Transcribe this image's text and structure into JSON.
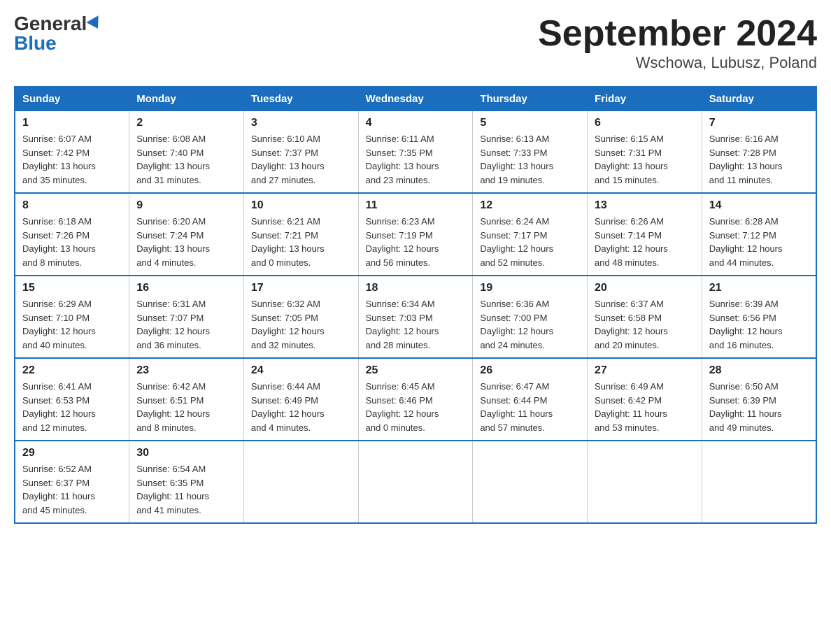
{
  "header": {
    "logo_general": "General",
    "logo_blue": "Blue",
    "month_title": "September 2024",
    "location": "Wschowa, Lubusz, Poland"
  },
  "days_of_week": [
    "Sunday",
    "Monday",
    "Tuesday",
    "Wednesday",
    "Thursday",
    "Friday",
    "Saturday"
  ],
  "weeks": [
    [
      {
        "day": "1",
        "sunrise": "6:07 AM",
        "sunset": "7:42 PM",
        "daylight": "13 hours and 35 minutes."
      },
      {
        "day": "2",
        "sunrise": "6:08 AM",
        "sunset": "7:40 PM",
        "daylight": "13 hours and 31 minutes."
      },
      {
        "day": "3",
        "sunrise": "6:10 AM",
        "sunset": "7:37 PM",
        "daylight": "13 hours and 27 minutes."
      },
      {
        "day": "4",
        "sunrise": "6:11 AM",
        "sunset": "7:35 PM",
        "daylight": "13 hours and 23 minutes."
      },
      {
        "day": "5",
        "sunrise": "6:13 AM",
        "sunset": "7:33 PM",
        "daylight": "13 hours and 19 minutes."
      },
      {
        "day": "6",
        "sunrise": "6:15 AM",
        "sunset": "7:31 PM",
        "daylight": "13 hours and 15 minutes."
      },
      {
        "day": "7",
        "sunrise": "6:16 AM",
        "sunset": "7:28 PM",
        "daylight": "13 hours and 11 minutes."
      }
    ],
    [
      {
        "day": "8",
        "sunrise": "6:18 AM",
        "sunset": "7:26 PM",
        "daylight": "13 hours and 8 minutes."
      },
      {
        "day": "9",
        "sunrise": "6:20 AM",
        "sunset": "7:24 PM",
        "daylight": "13 hours and 4 minutes."
      },
      {
        "day": "10",
        "sunrise": "6:21 AM",
        "sunset": "7:21 PM",
        "daylight": "13 hours and 0 minutes."
      },
      {
        "day": "11",
        "sunrise": "6:23 AM",
        "sunset": "7:19 PM",
        "daylight": "12 hours and 56 minutes."
      },
      {
        "day": "12",
        "sunrise": "6:24 AM",
        "sunset": "7:17 PM",
        "daylight": "12 hours and 52 minutes."
      },
      {
        "day": "13",
        "sunrise": "6:26 AM",
        "sunset": "7:14 PM",
        "daylight": "12 hours and 48 minutes."
      },
      {
        "day": "14",
        "sunrise": "6:28 AM",
        "sunset": "7:12 PM",
        "daylight": "12 hours and 44 minutes."
      }
    ],
    [
      {
        "day": "15",
        "sunrise": "6:29 AM",
        "sunset": "7:10 PM",
        "daylight": "12 hours and 40 minutes."
      },
      {
        "day": "16",
        "sunrise": "6:31 AM",
        "sunset": "7:07 PM",
        "daylight": "12 hours and 36 minutes."
      },
      {
        "day": "17",
        "sunrise": "6:32 AM",
        "sunset": "7:05 PM",
        "daylight": "12 hours and 32 minutes."
      },
      {
        "day": "18",
        "sunrise": "6:34 AM",
        "sunset": "7:03 PM",
        "daylight": "12 hours and 28 minutes."
      },
      {
        "day": "19",
        "sunrise": "6:36 AM",
        "sunset": "7:00 PM",
        "daylight": "12 hours and 24 minutes."
      },
      {
        "day": "20",
        "sunrise": "6:37 AM",
        "sunset": "6:58 PM",
        "daylight": "12 hours and 20 minutes."
      },
      {
        "day": "21",
        "sunrise": "6:39 AM",
        "sunset": "6:56 PM",
        "daylight": "12 hours and 16 minutes."
      }
    ],
    [
      {
        "day": "22",
        "sunrise": "6:41 AM",
        "sunset": "6:53 PM",
        "daylight": "12 hours and 12 minutes."
      },
      {
        "day": "23",
        "sunrise": "6:42 AM",
        "sunset": "6:51 PM",
        "daylight": "12 hours and 8 minutes."
      },
      {
        "day": "24",
        "sunrise": "6:44 AM",
        "sunset": "6:49 PM",
        "daylight": "12 hours and 4 minutes."
      },
      {
        "day": "25",
        "sunrise": "6:45 AM",
        "sunset": "6:46 PM",
        "daylight": "12 hours and 0 minutes."
      },
      {
        "day": "26",
        "sunrise": "6:47 AM",
        "sunset": "6:44 PM",
        "daylight": "11 hours and 57 minutes."
      },
      {
        "day": "27",
        "sunrise": "6:49 AM",
        "sunset": "6:42 PM",
        "daylight": "11 hours and 53 minutes."
      },
      {
        "day": "28",
        "sunrise": "6:50 AM",
        "sunset": "6:39 PM",
        "daylight": "11 hours and 49 minutes."
      }
    ],
    [
      {
        "day": "29",
        "sunrise": "6:52 AM",
        "sunset": "6:37 PM",
        "daylight": "11 hours and 45 minutes."
      },
      {
        "day": "30",
        "sunrise": "6:54 AM",
        "sunset": "6:35 PM",
        "daylight": "11 hours and 41 minutes."
      },
      null,
      null,
      null,
      null,
      null
    ]
  ]
}
